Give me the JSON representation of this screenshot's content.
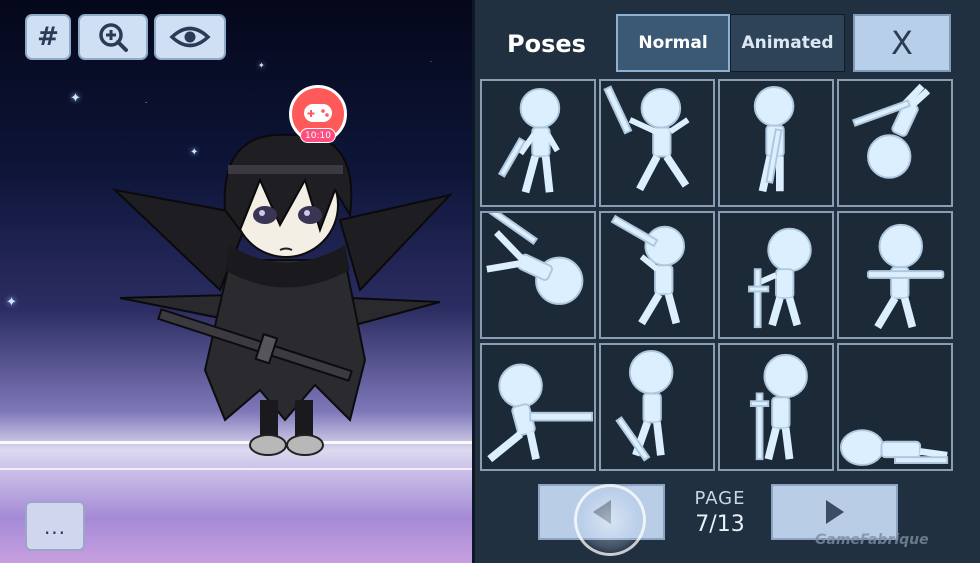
{
  "toolbar": {
    "grid_button": {
      "label": "#",
      "icon": "hash-icon"
    },
    "zoom_button": {
      "icon": "zoom-in-icon"
    },
    "visibility_button": {
      "icon": "eye-icon"
    },
    "more_button": {
      "label": "..."
    }
  },
  "recorder_badge": {
    "icon": "gamepad-icon",
    "time": "10:10"
  },
  "panel": {
    "title": "Poses",
    "tabs": [
      {
        "label": "Normal",
        "active": true
      },
      {
        "label": "Animated",
        "active": false
      }
    ],
    "close_label": "X",
    "poses": [
      {
        "name": "pose-1"
      },
      {
        "name": "pose-2"
      },
      {
        "name": "pose-3"
      },
      {
        "name": "pose-4"
      },
      {
        "name": "pose-5"
      },
      {
        "name": "pose-6"
      },
      {
        "name": "pose-7"
      },
      {
        "name": "pose-8"
      },
      {
        "name": "pose-9"
      },
      {
        "name": "pose-10"
      },
      {
        "name": "pose-11"
      },
      {
        "name": "pose-12"
      }
    ],
    "pager": {
      "page_label": "PAGE",
      "page_value": "7/13",
      "prev_icon": "arrow-left-icon",
      "next_icon": "play-right-icon"
    }
  },
  "watermark": "GameFabrique",
  "colors": {
    "panel_bg": "#213040",
    "tab_active": "#3b5874",
    "button_light": "#b9cde6",
    "pose_figure": "#dcefff",
    "record_red": "#ff5a5a"
  }
}
